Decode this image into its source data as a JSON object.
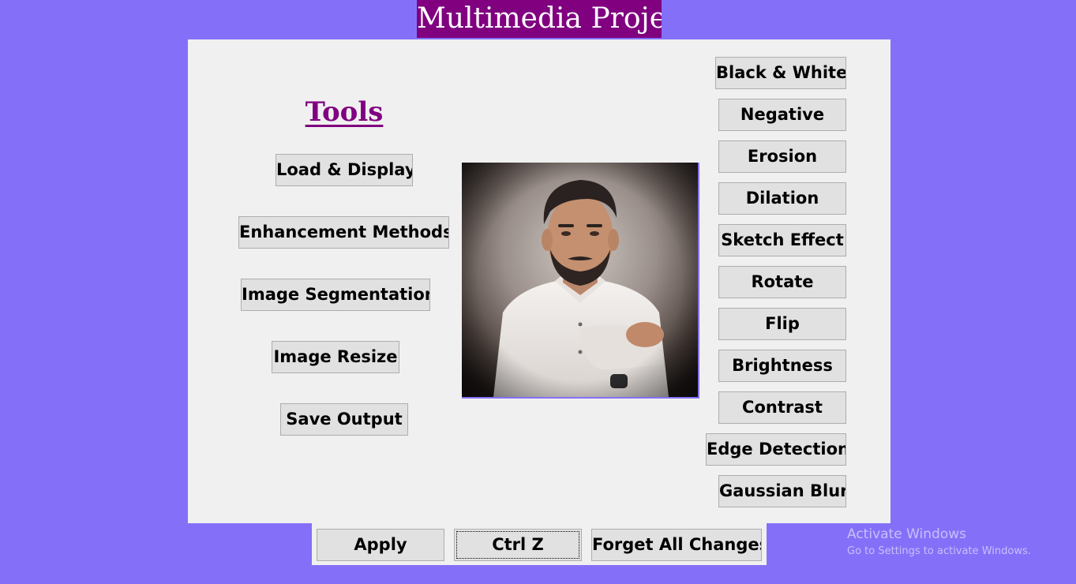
{
  "window": {
    "title": "Multimedia Project"
  },
  "tools_panel": {
    "heading": "Tools",
    "buttons": {
      "load_display": "Load & Display",
      "enhancement": "Enhancement Methods",
      "segmentation": "Image Segmentation",
      "resize": "Image Resize",
      "save_output": "Save Output"
    }
  },
  "image": {
    "alt": "Loaded photo of a man in a white shirt"
  },
  "effects": {
    "black_white": "Black & White",
    "negative": "Negative",
    "erosion": "Erosion",
    "dilation": "Dilation",
    "sketch": "Sketch Effect",
    "rotate": "Rotate",
    "flip": "Flip",
    "brightness": "Brightness",
    "contrast": "Contrast",
    "edge_detection": "Edge Detection",
    "gaussian_blur": "Gaussian Blur"
  },
  "actions": {
    "apply": "Apply",
    "undo": "Ctrl Z",
    "forget": "Forget All Changes"
  },
  "watermark": {
    "line1": "Activate Windows",
    "line2": "Go to Settings to activate Windows."
  },
  "colors": {
    "background": "#8470f8",
    "title_bg": "#800080",
    "heading": "#800080",
    "panel": "#f0f0f0",
    "button": "#e1e1e1"
  }
}
